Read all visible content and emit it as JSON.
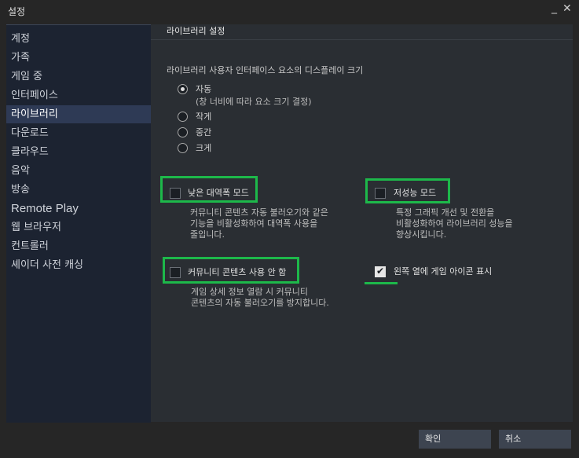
{
  "window": {
    "title": "설정",
    "minimize_glyph": "_",
    "close_glyph": "✕"
  },
  "sidebar": {
    "items": [
      {
        "label": "계정"
      },
      {
        "label": "가족"
      },
      {
        "label": "게임 중"
      },
      {
        "label": "인터페이스"
      },
      {
        "label": "라이브러리",
        "active": true
      },
      {
        "label": "다운로드"
      },
      {
        "label": "클라우드"
      },
      {
        "label": "음악"
      },
      {
        "label": "방송"
      },
      {
        "label": "Remote Play"
      },
      {
        "label": "웹 브라우저"
      },
      {
        "label": "컨트롤러"
      },
      {
        "label": "셰이더 사전 캐싱"
      }
    ]
  },
  "content": {
    "section_title": "라이브러리 설정",
    "display_size": {
      "label": "라이브러리 사용자 인터페이스 요소의 디스플레이 크기",
      "options": [
        {
          "label": "자동",
          "sub": "(창 너비에 따라 요소 크기 결정)",
          "selected": true
        },
        {
          "label": "작게"
        },
        {
          "label": "중간"
        },
        {
          "label": "크게"
        }
      ]
    },
    "options": {
      "low_bandwidth": {
        "label": "낮은 대역폭 모드",
        "checked": false,
        "desc": [
          "커뮤니티 콘텐츠 자동 불러오기와 같은",
          "기능을 비활성화하여 대역폭 사용을",
          "줄입니다."
        ]
      },
      "low_perf": {
        "label": "저성능 모드",
        "checked": false,
        "desc": [
          "특정 그래픽 개선 및 전환을",
          "비활성화하여 라이브러리 성능을",
          "향상시킵니다."
        ]
      },
      "no_community": {
        "label": "커뮤니티 콘텐츠 사용 안 함",
        "checked": false,
        "desc": [
          "게임 상세 정보 열람 시 커뮤니티",
          "콘텐츠의 자동 불러오기를 방지합니다."
        ]
      },
      "game_icons": {
        "label": "왼쪽 열에 게임 아이콘 표시",
        "checked": true
      }
    },
    "highlight_color": "#1db84a"
  },
  "footer": {
    "ok_label": "확인",
    "cancel_label": "취소"
  }
}
